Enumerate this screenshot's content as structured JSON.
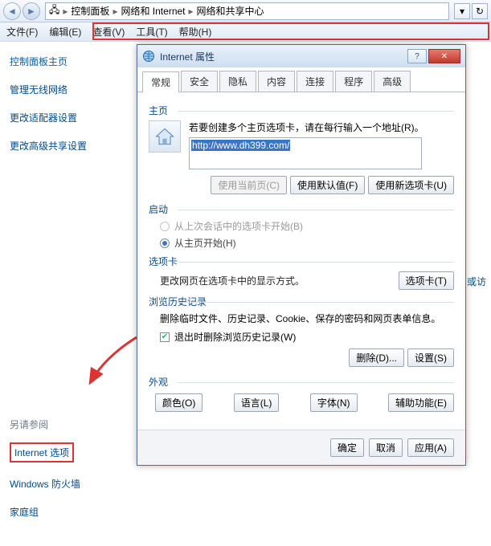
{
  "addressbar": {
    "crumbs": [
      "控制面板",
      "网络和 Internet",
      "网络和共享中心"
    ]
  },
  "menubar": {
    "items": [
      "文件(F)",
      "编辑(E)",
      "查看(V)",
      "工具(T)",
      "帮助(H)"
    ]
  },
  "sidebar": {
    "main": "控制面板主页",
    "links": [
      "管理无线网络",
      "更改适配器设置",
      "更改高级共享设置"
    ],
    "see_also_title": "另请参阅",
    "see_also": [
      "Internet 选项",
      "Windows 防火墙",
      "家庭组"
    ]
  },
  "rightstrip": {
    "label": "或访"
  },
  "dialog": {
    "title": "Internet 属性",
    "tabs": [
      "常规",
      "安全",
      "隐私",
      "内容",
      "连接",
      "程序",
      "高级"
    ],
    "active_tab": 0,
    "homepage": {
      "group": "主页",
      "desc": "若要创建多个主页选项卡，请在每行输入一个地址(R)。",
      "url": "http://www.dh399.com/",
      "btn_current": "使用当前页(C)",
      "btn_default": "使用默认值(F)",
      "btn_newtab": "使用新选项卡(U)"
    },
    "startup": {
      "group": "启动",
      "opt1": "从上次会话中的选项卡开始(B)",
      "opt2": "从主页开始(H)",
      "selected": 2
    },
    "tabs_section": {
      "group": "选项卡",
      "desc": "更改网页在选项卡中的显示方式。",
      "btn": "选项卡(T)"
    },
    "history": {
      "group": "浏览历史记录",
      "desc": "删除临时文件、历史记录、Cookie、保存的密码和网页表单信息。",
      "cb_label": "退出时删除浏览历史记录(W)",
      "cb_checked": true,
      "btn_delete": "删除(D)...",
      "btn_settings": "设置(S)"
    },
    "appearance": {
      "group": "外观",
      "btn_colors": "颜色(O)",
      "btn_lang": "语言(L)",
      "btn_fonts": "字体(N)",
      "btn_access": "辅助功能(E)"
    },
    "footer": {
      "ok": "确定",
      "cancel": "取消",
      "apply": "应用(A)"
    }
  }
}
